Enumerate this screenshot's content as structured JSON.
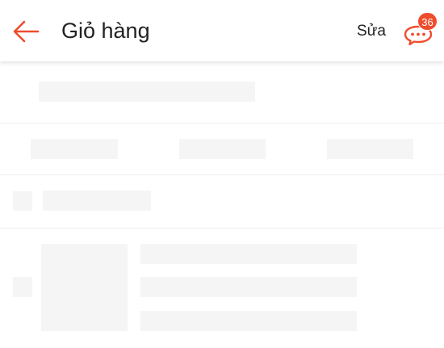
{
  "header": {
    "title": "Giỏ hàng",
    "edit_label": "Sửa",
    "back_icon": "arrow-left-icon",
    "chat_icon": "chat-bubbles-icon",
    "chat_badge_count": "36"
  },
  "colors": {
    "accent": "#ee4d2d",
    "text": "#222222",
    "skeleton": "#f5f5f5",
    "divider": "#efefef"
  }
}
